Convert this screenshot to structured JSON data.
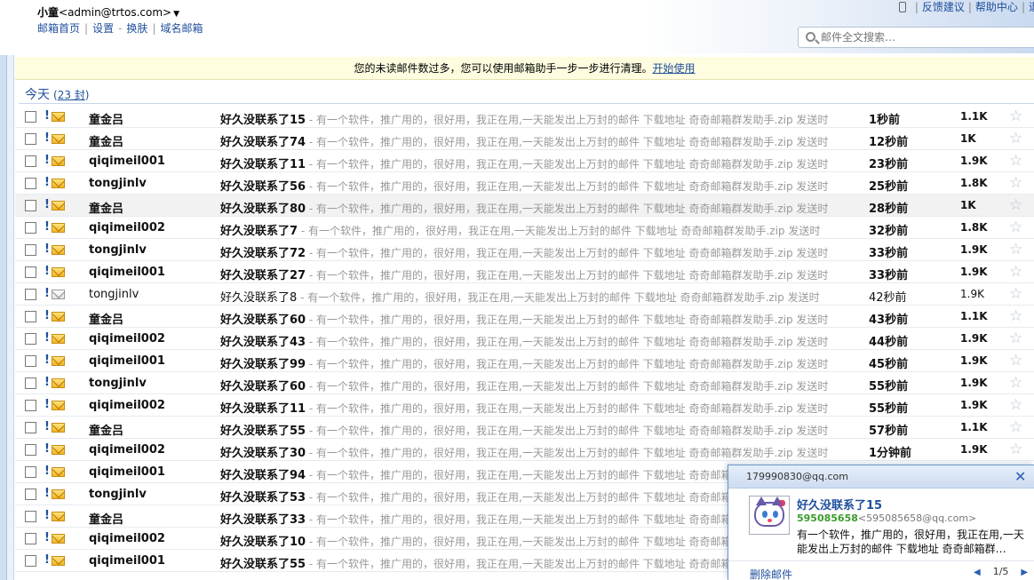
{
  "header": {
    "nickname": "小童",
    "email": "<admin@trtos.com>",
    "nav": [
      "邮箱首页",
      "设置",
      "换肤",
      "域名邮箱"
    ],
    "top_links": [
      "反馈建议",
      "帮助中心",
      "退"
    ],
    "search_placeholder": "邮件全文搜索…"
  },
  "notice": {
    "text": "您的未读邮件数过多，您可以使用邮箱助手一步一步进行清理。",
    "link": "开始使用"
  },
  "group": {
    "label": "今天",
    "count": "23 封"
  },
  "preview_suffix": " - 有一个软件，推广用的，很好用，我正在用,一天能发出上万封的邮件 下载地址 奇奇邮箱群发助手.zip  发送时",
  "emails": [
    {
      "from": "童金吕",
      "subject": "好久没联系了15",
      "time": "1秒前",
      "size": "1.1K",
      "read": false
    },
    {
      "from": "童金吕",
      "subject": "好久没联系了74",
      "time": "12秒前",
      "size": "1K",
      "read": false
    },
    {
      "from": "qiqimeil001",
      "subject": "好久没联系了11",
      "time": "23秒前",
      "size": "1.9K",
      "read": false
    },
    {
      "from": "tongjinlv",
      "subject": "好久没联系了56",
      "time": "25秒前",
      "size": "1.8K",
      "read": false
    },
    {
      "from": "童金吕",
      "subject": "好久没联系了80",
      "time": "28秒前",
      "size": "1K",
      "read": false
    },
    {
      "from": "qiqimeil002",
      "subject": "好久没联系了7",
      "time": "32秒前",
      "size": "1.8K",
      "read": false
    },
    {
      "from": "tongjinlv",
      "subject": "好久没联系了72",
      "time": "33秒前",
      "size": "1.9K",
      "read": false
    },
    {
      "from": "qiqimeil001",
      "subject": "好久没联系了27",
      "time": "33秒前",
      "size": "1.9K",
      "read": false
    },
    {
      "from": "tongjinlv",
      "subject": "好久没联系了8",
      "time": "42秒前",
      "size": "1.9K",
      "read": true
    },
    {
      "from": "童金吕",
      "subject": "好久没联系了60",
      "time": "43秒前",
      "size": "1.1K",
      "read": false
    },
    {
      "from": "qiqimeil002",
      "subject": "好久没联系了43",
      "time": "44秒前",
      "size": "1.9K",
      "read": false
    },
    {
      "from": "qiqimeil001",
      "subject": "好久没联系了99",
      "time": "45秒前",
      "size": "1.9K",
      "read": false
    },
    {
      "from": "tongjinlv",
      "subject": "好久没联系了60",
      "time": "55秒前",
      "size": "1.9K",
      "read": false
    },
    {
      "from": "qiqimeil002",
      "subject": "好久没联系了11",
      "time": "55秒前",
      "size": "1.9K",
      "read": false
    },
    {
      "from": "童金吕",
      "subject": "好久没联系了55",
      "time": "57秒前",
      "size": "1.1K",
      "read": false
    },
    {
      "from": "qiqimeil002",
      "subject": "好久没联系了30",
      "time": "1分钟前",
      "size": "1.9K",
      "read": false
    },
    {
      "from": "qiqimeil001",
      "subject": "好久没联系了94",
      "time": "",
      "size": "",
      "read": false
    },
    {
      "from": "tongjinlv",
      "subject": "好久没联系了53",
      "time": "",
      "size": "",
      "read": false
    },
    {
      "from": "童金吕",
      "subject": "好久没联系了33",
      "time": "",
      "size": "",
      "read": false
    },
    {
      "from": "qiqimeil002",
      "subject": "好久没联系了10",
      "time": "",
      "size": "",
      "read": false
    },
    {
      "from": "qiqimeil001",
      "subject": "好久没联系了55",
      "time": "",
      "size": "",
      "read": false
    }
  ],
  "popup": {
    "account": "179990830@qq.com",
    "subject": "好久没联系了15",
    "sender_name": "595085658",
    "sender_addr": "<595085658@qq.com>",
    "body": "有一个软件，推广用的，很好用，我正在用,一天能发出上万封的邮件 下载地址 奇奇邮箱群…",
    "delete_label": "删除邮件",
    "page": "1/5"
  },
  "colors": {
    "link": "#1f4f9c",
    "preview": "#999999",
    "notice_bg": "#fffde0"
  }
}
